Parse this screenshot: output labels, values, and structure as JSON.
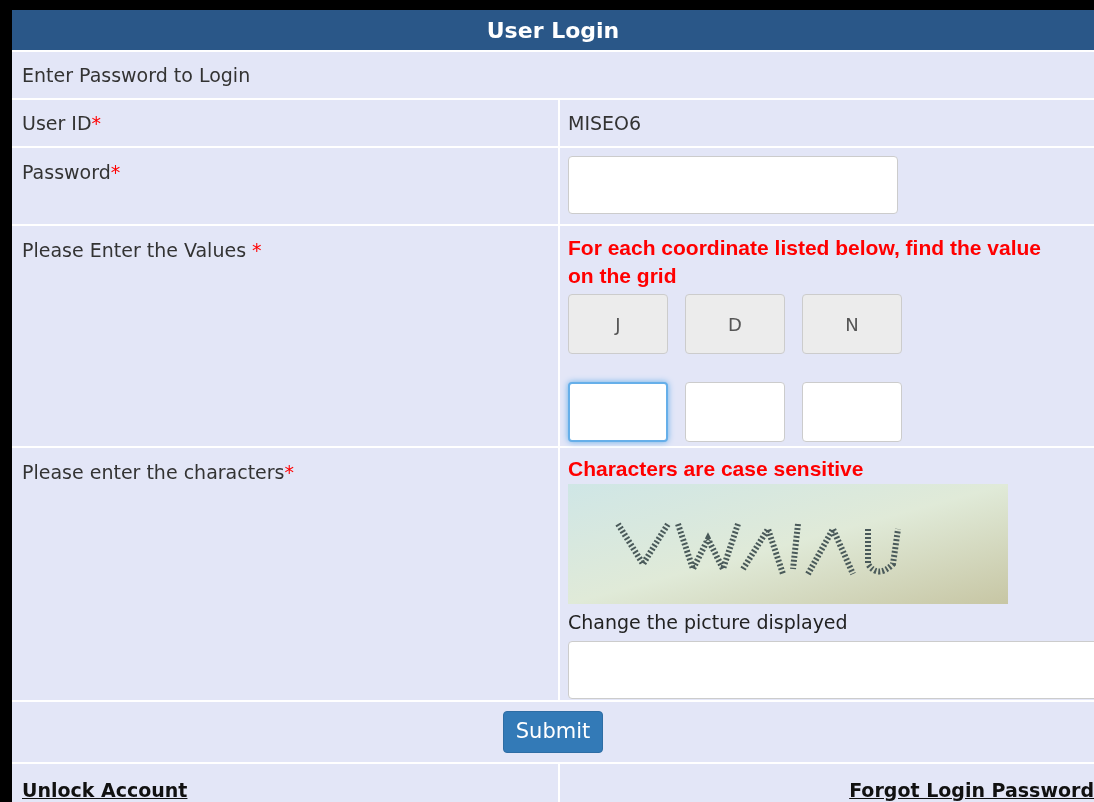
{
  "header": {
    "title": "User Login"
  },
  "intro": "Enter Password to Login",
  "user_id": {
    "label": "User ID",
    "required_mark": "*",
    "value": "MISEO6"
  },
  "password": {
    "label": "Password",
    "required_mark": "*"
  },
  "grid_values": {
    "label": "Please Enter the Values",
    "required_mark": "*",
    "instruction": "For each coordinate listed below, find the value on the grid",
    "coordinates": [
      {
        "value": "J"
      },
      {
        "value": "D"
      },
      {
        "value": "N"
      }
    ],
    "answers": [
      {
        "focused": true
      },
      {
        "focused": false
      },
      {
        "focused": false
      }
    ]
  },
  "captcha": {
    "label": "Please enter the characters",
    "required_mark": "*",
    "note": "Characters are case sensitive",
    "change_link": "Change the picture displayed"
  },
  "submit": "Submit",
  "links": [
    "Unlock Account",
    "Forgot Login Password"
  ]
}
